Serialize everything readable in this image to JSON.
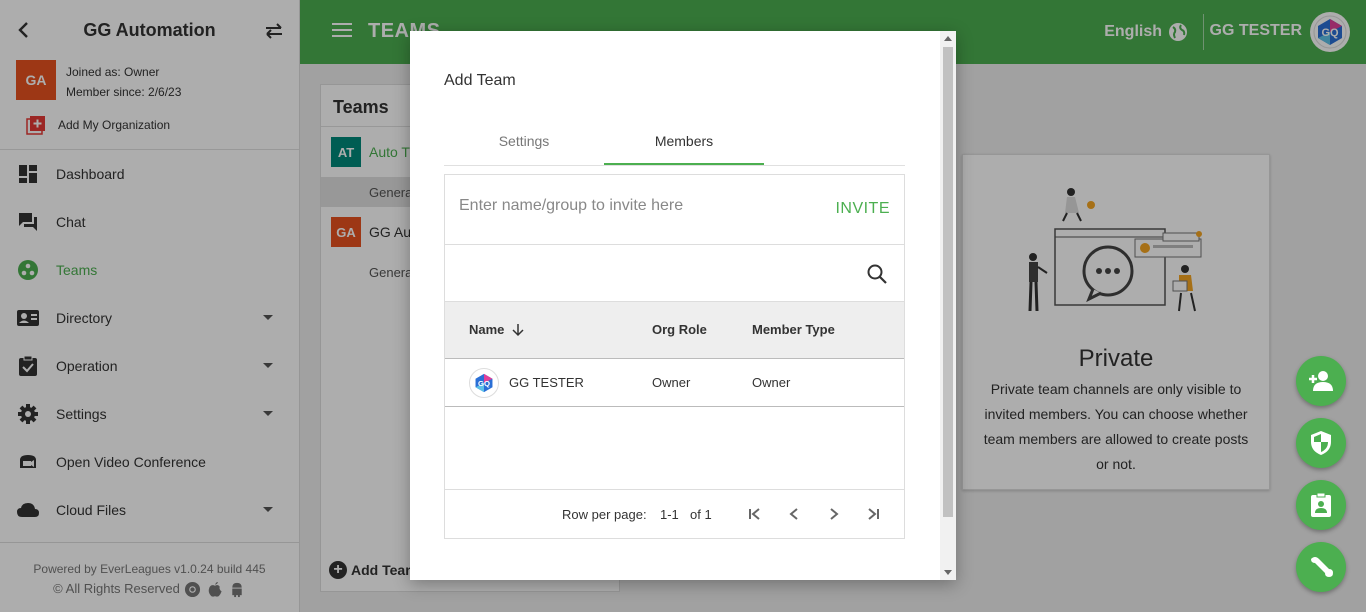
{
  "sidebar": {
    "org_name": "GG Automation",
    "org_avatar": "GA",
    "joined_as": "Joined as: Owner",
    "member_since": "Member since: 2/6/23",
    "add_org_label": "Add My Organization",
    "items": [
      {
        "label": "Dashboard",
        "icon": "dashboard-icon"
      },
      {
        "label": "Chat",
        "icon": "chat-icon"
      },
      {
        "label": "Teams",
        "icon": "teams-icon"
      },
      {
        "label": "Directory",
        "icon": "directory-icon"
      },
      {
        "label": "Operation",
        "icon": "operation-icon"
      },
      {
        "label": "Settings",
        "icon": "gear-icon"
      },
      {
        "label": "Open Video Conference",
        "icon": "video-icon"
      },
      {
        "label": "Cloud Files",
        "icon": "cloud-icon"
      }
    ],
    "footer_powered": "Powered by EverLeagues v1.0.24 build 445",
    "footer_rights": "© All Rights Reserved"
  },
  "topbar": {
    "title": "TEAMS",
    "language": "English",
    "user_name": "GG TESTER",
    "accent": "#4caf50"
  },
  "teams_panel": {
    "title": "Teams",
    "teams": [
      {
        "badge": "AT",
        "name": "Auto T",
        "color": "#00897b",
        "channel": "Genera"
      },
      {
        "badge": "GA",
        "name": "GG Aut",
        "color": "#e8511f",
        "channel": "Genera"
      }
    ],
    "add_team_label": "Add Team"
  },
  "private_card": {
    "title": "Private",
    "description": "Private team channels are only visible to invited members. You can choose whether team members are allowed to create posts or not."
  },
  "modal": {
    "title": "Add Team",
    "tabs": [
      "Settings",
      "Members"
    ],
    "invite_placeholder": "Enter name/group to invite here",
    "invite_label": "INVITE",
    "columns": [
      "Name",
      "Org Role",
      "Member Type"
    ],
    "rows": [
      {
        "name": "GG TESTER",
        "org_role": "Owner",
        "member_type": "Owner"
      }
    ],
    "pager": {
      "rows_per_page_label": "Row per page:",
      "range": "1-1",
      "of": "of 1"
    }
  }
}
